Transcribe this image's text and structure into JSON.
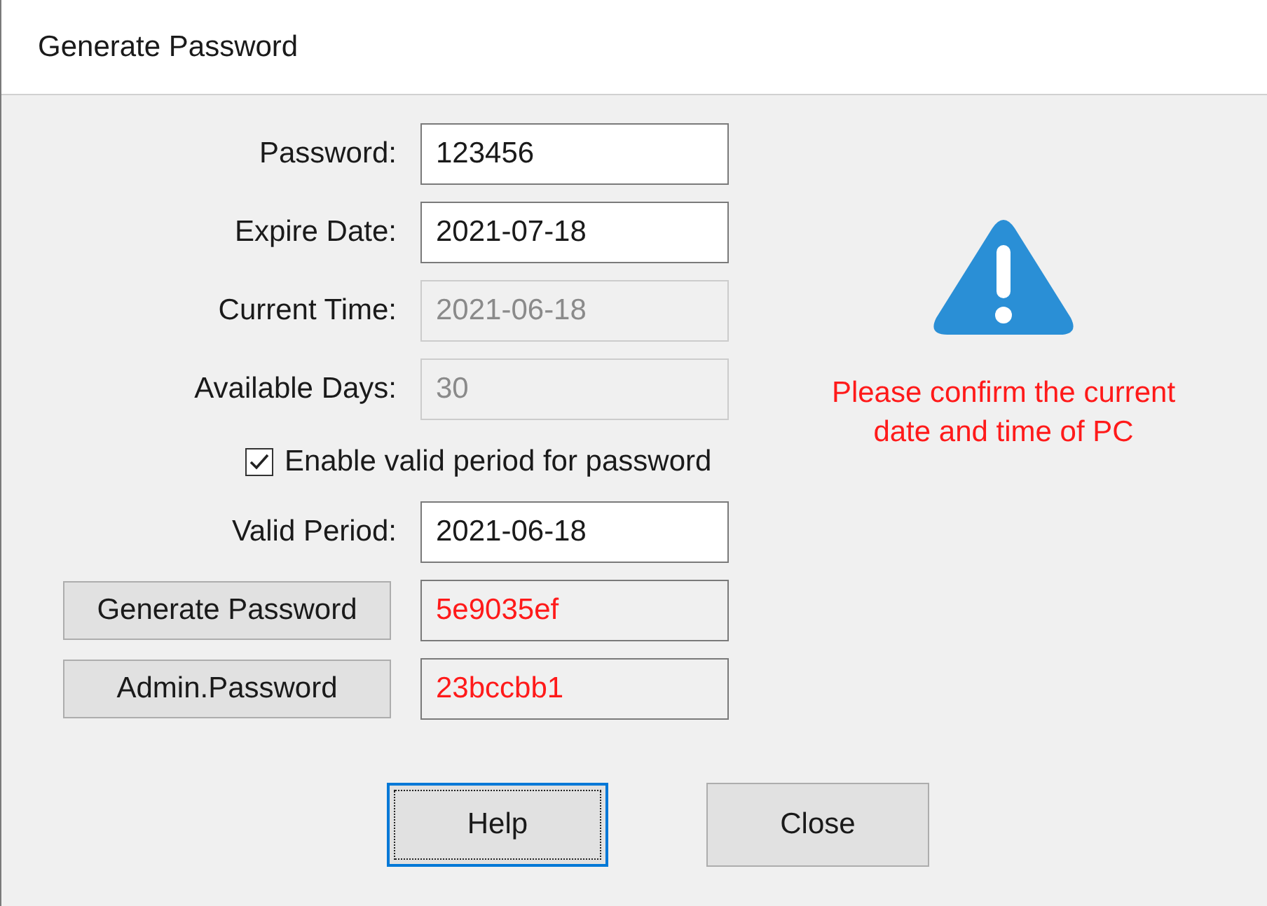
{
  "window": {
    "title": "Generate Password"
  },
  "fields": [
    {
      "label": "Password:",
      "value": "123456",
      "disabled": false
    },
    {
      "label": "Expire Date:",
      "value": "2021-07-18",
      "disabled": false
    },
    {
      "label": "Current Time:",
      "value": "2021-06-18",
      "disabled": true
    },
    {
      "label": "Available Days:",
      "value": "30",
      "disabled": true
    }
  ],
  "enable_valid_period": {
    "label": "Enable valid period for password",
    "checked": true
  },
  "valid_period": {
    "label": "Valid Period:",
    "value": "2021-06-18"
  },
  "generated": [
    {
      "button": "Generate Password",
      "value": "5e9035ef"
    },
    {
      "button": "Admin.Password",
      "value": "23bccbb1"
    }
  ],
  "warning": {
    "lines": [
      "Please confirm the current",
      "date and time of PC"
    ]
  },
  "buttons": [
    {
      "label": "Help",
      "focused": true
    },
    {
      "label": "Close",
      "focused": false
    }
  ]
}
